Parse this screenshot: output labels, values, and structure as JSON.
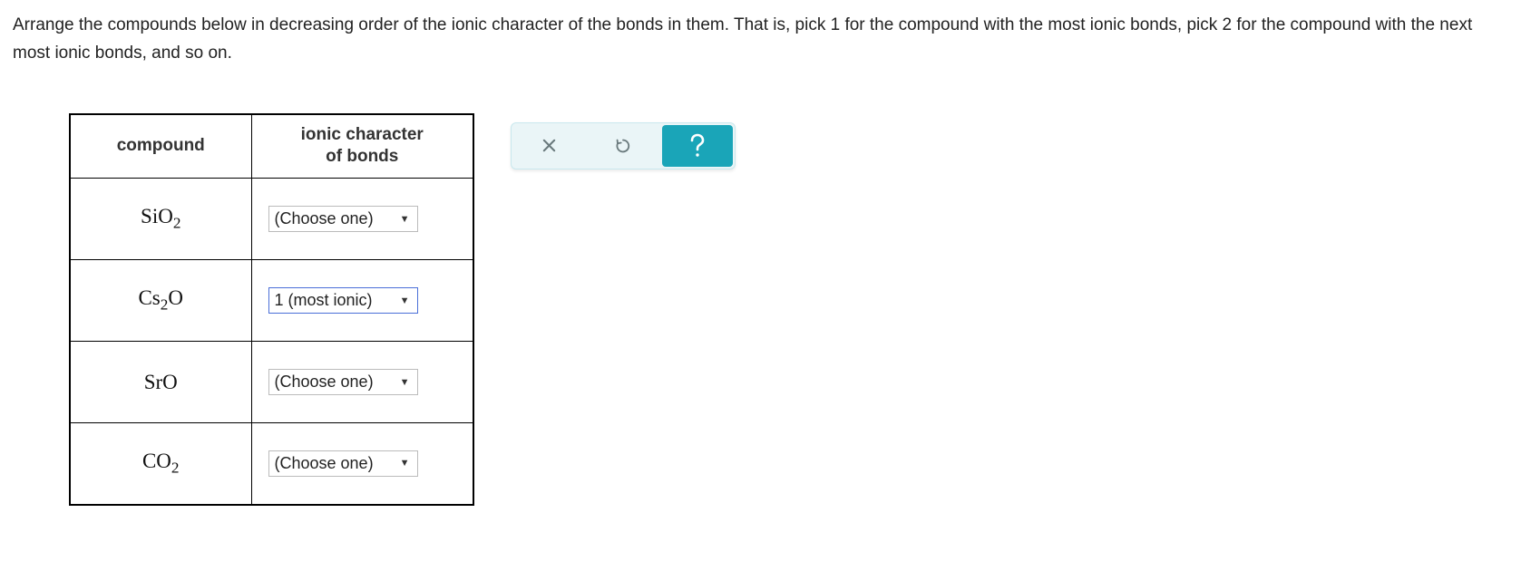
{
  "question": {
    "text": "Arrange the compounds below in decreasing order of the ionic character of the bonds in them. That is, pick 1 for the compound with the most ionic bonds, pick 2 for the compound with the next most ionic bonds, and so on."
  },
  "table": {
    "headers": {
      "compound": "compound",
      "ionic": "ionic character of bonds"
    },
    "placeholder": "(Choose one)",
    "rows": [
      {
        "compound_html": "SiO<sub>2</sub>",
        "selected": ""
      },
      {
        "compound_html": "Cs<sub>2</sub>O",
        "selected": "1 (most ionic)"
      },
      {
        "compound_html": "SrO",
        "selected": ""
      },
      {
        "compound_html": "CO<sub>2</sub>",
        "selected": ""
      }
    ]
  },
  "toolbar": {
    "clear": "clear",
    "reset": "reset",
    "help": "help"
  }
}
